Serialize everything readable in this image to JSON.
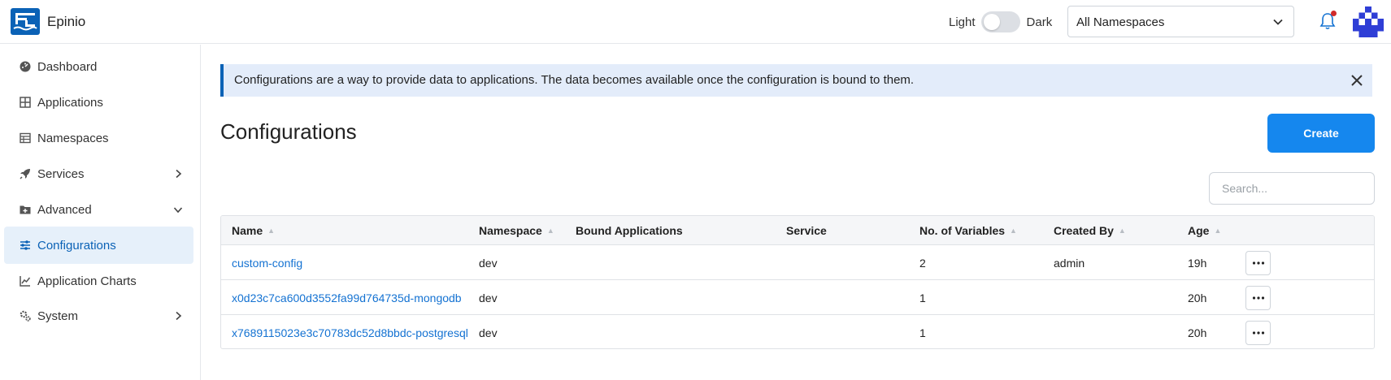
{
  "header": {
    "app_name": "Epinio",
    "theme_light_label": "Light",
    "theme_dark_label": "Dark",
    "namespace_select": "All Namespaces"
  },
  "sidebar": {
    "items": [
      {
        "label": "Dashboard",
        "icon": "dashboard-icon"
      },
      {
        "label": "Applications",
        "icon": "grid-icon"
      },
      {
        "label": "Namespaces",
        "icon": "table-icon"
      },
      {
        "label": "Services",
        "icon": "rocket-icon",
        "expand": "chevron-right"
      },
      {
        "label": "Advanced",
        "icon": "folder-plus-icon",
        "expand": "chevron-down"
      },
      {
        "label": "Configurations",
        "icon": "sliders-icon",
        "active": true
      },
      {
        "label": "Application Charts",
        "icon": "chart-line-icon"
      },
      {
        "label": "System",
        "icon": "gears-icon",
        "expand": "chevron-right"
      }
    ]
  },
  "main": {
    "banner_text": "Configurations are a way to provide data to applications. The data becomes available once the configuration is bound to them.",
    "title": "Configurations",
    "create_label": "Create",
    "search_placeholder": "Search..."
  },
  "table": {
    "columns": [
      "Name",
      "Namespace",
      "Bound Applications",
      "Service",
      "No. of Variables",
      "Created By",
      "Age"
    ],
    "rows": [
      {
        "name": "custom-config",
        "namespace": "dev",
        "bound": "",
        "service": "",
        "variables": "2",
        "created_by": "admin",
        "age": "19h"
      },
      {
        "name": "x0d23c7ca600d3552fa99d764735d-mongodb",
        "namespace": "dev",
        "bound": "",
        "service": "",
        "variables": "1",
        "created_by": "",
        "age": "20h"
      },
      {
        "name": "x7689115023e3c70783dc52d8bbdc-postgresql",
        "namespace": "dev",
        "bound": "",
        "service": "",
        "variables": "1",
        "created_by": "",
        "age": "20h"
      }
    ]
  },
  "colors": {
    "accent": "#0b62b6",
    "button": "#1587ee",
    "link": "#1472d2",
    "banner_bg": "#e3ecfa",
    "notification_dot": "#d12a2a"
  }
}
